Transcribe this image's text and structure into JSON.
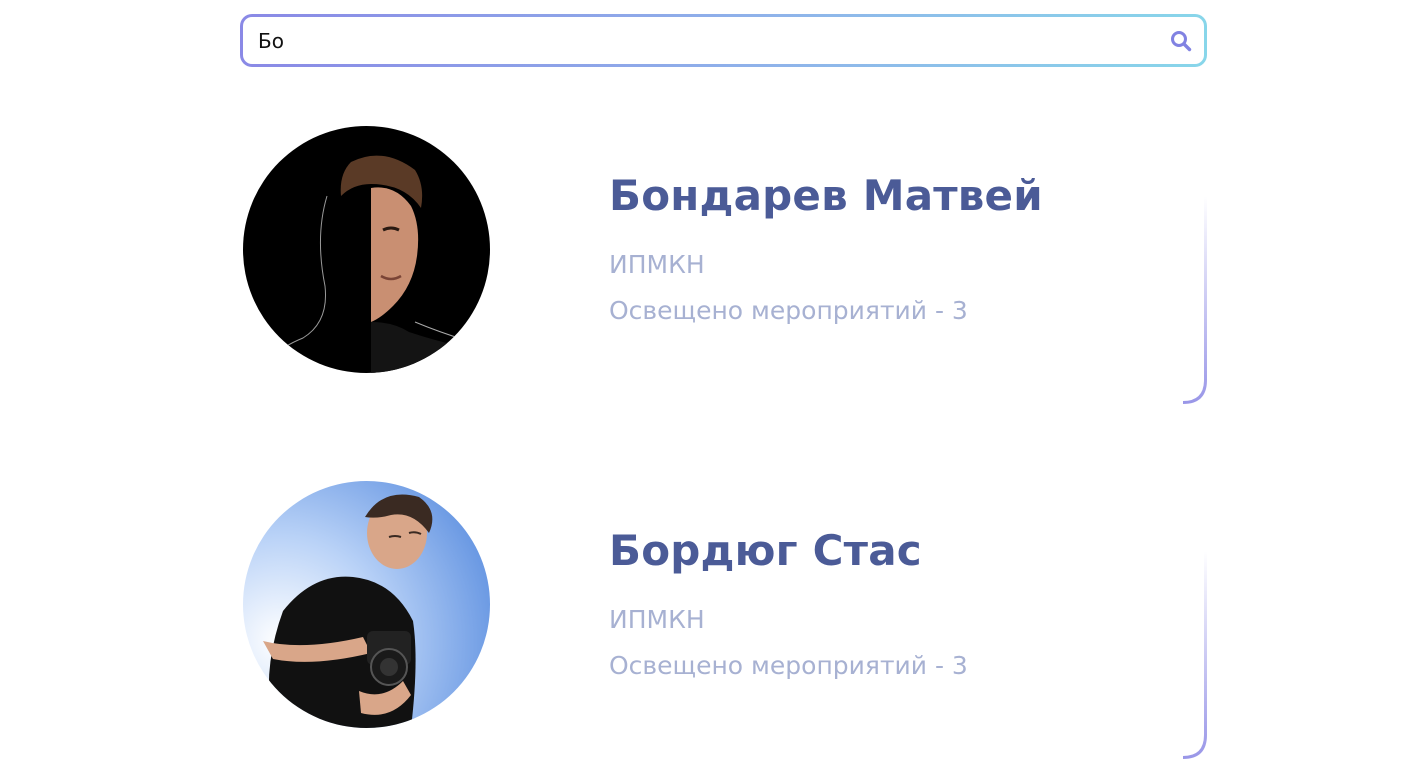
{
  "search": {
    "value": "Бо",
    "icon": "search-icon",
    "accent_colors": [
      "#8a89e6",
      "#88d6ea"
    ]
  },
  "results": [
    {
      "name": "Бондарев Матвей",
      "department": "ИПМКН",
      "events_label": "Освещено мероприятий - 3",
      "photo_background": "#000000"
    },
    {
      "name": "Бордюг Стас",
      "department": "ИПМКН",
      "events_label": "Освещено мероприятий - 3",
      "photo_background": "#6d9ee8"
    }
  ],
  "colors": {
    "name": "#4b5b97",
    "meta": "#a7b1d2",
    "card_accent": "#9a97e8"
  }
}
